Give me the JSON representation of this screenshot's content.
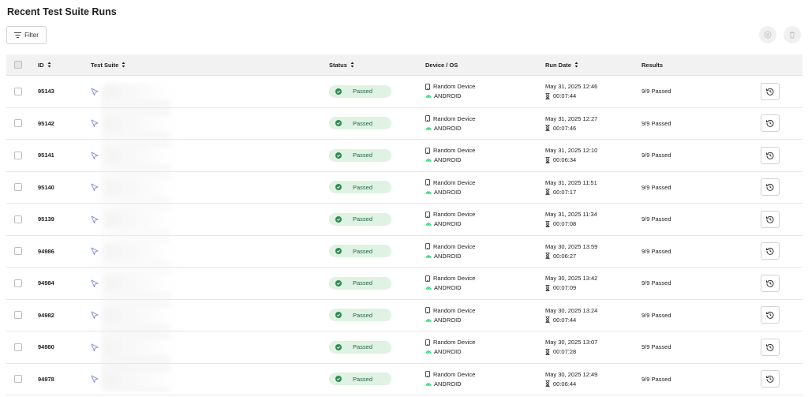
{
  "page": {
    "title": "Recent Test Suite Runs"
  },
  "toolbar": {
    "filter_label": "Filter",
    "icons": [
      "filter-icon",
      "cancel-icon",
      "trash-icon"
    ]
  },
  "columns": {
    "id": "ID",
    "suite": "Test Suite",
    "status": "Status",
    "device": "Device / OS",
    "date": "Run Date",
    "results": "Results"
  },
  "colors": {
    "passed_bg": "#dff2e4",
    "passed_icon": "#2e8b57",
    "android_green": "#3ddc84",
    "suite_icon": "#7a80d8"
  },
  "rows": [
    {
      "id": "95143",
      "status": "Passed",
      "device": "Random Device",
      "os": "ANDROID",
      "date": "May 31, 2025 12:46",
      "duration": "00:07:44",
      "results": "9/9 Passed"
    },
    {
      "id": "95142",
      "status": "Passed",
      "device": "Random Device",
      "os": "ANDROID",
      "date": "May 31, 2025 12:27",
      "duration": "00:07:46",
      "results": "9/9 Passed"
    },
    {
      "id": "95141",
      "status": "Passed",
      "device": "Random Device",
      "os": "ANDROID",
      "date": "May 31, 2025 12:10",
      "duration": "00:06:34",
      "results": "9/9 Passed"
    },
    {
      "id": "95140",
      "status": "Passed",
      "device": "Random Device",
      "os": "ANDROID",
      "date": "May 31, 2025 11:51",
      "duration": "00:07:17",
      "results": "9/9 Passed"
    },
    {
      "id": "95139",
      "status": "Passed",
      "device": "Random Device",
      "os": "ANDROID",
      "date": "May 31, 2025 11:34",
      "duration": "00:07:08",
      "results": "9/9 Passed"
    },
    {
      "id": "94986",
      "status": "Passed",
      "device": "Random Device",
      "os": "ANDROID",
      "date": "May 30, 2025 13:59",
      "duration": "00:06:27",
      "results": "9/9 Passed"
    },
    {
      "id": "94984",
      "status": "Passed",
      "device": "Random Device",
      "os": "ANDROID",
      "date": "May 30, 2025 13:42",
      "duration": "00:07:09",
      "results": "9/9 Passed"
    },
    {
      "id": "94982",
      "status": "Passed",
      "device": "Random Device",
      "os": "ANDROID",
      "date": "May 30, 2025 13:24",
      "duration": "00:07:44",
      "results": "9/9 Passed"
    },
    {
      "id": "94980",
      "status": "Passed",
      "device": "Random Device",
      "os": "ANDROID",
      "date": "May 30, 2025 13:07",
      "duration": "00:07:28",
      "results": "9/9 Passed"
    },
    {
      "id": "94978",
      "status": "Passed",
      "device": "Random Device",
      "os": "ANDROID",
      "date": "May 30, 2025 12:49",
      "duration": "00:06:44",
      "results": "9/9 Passed"
    }
  ]
}
